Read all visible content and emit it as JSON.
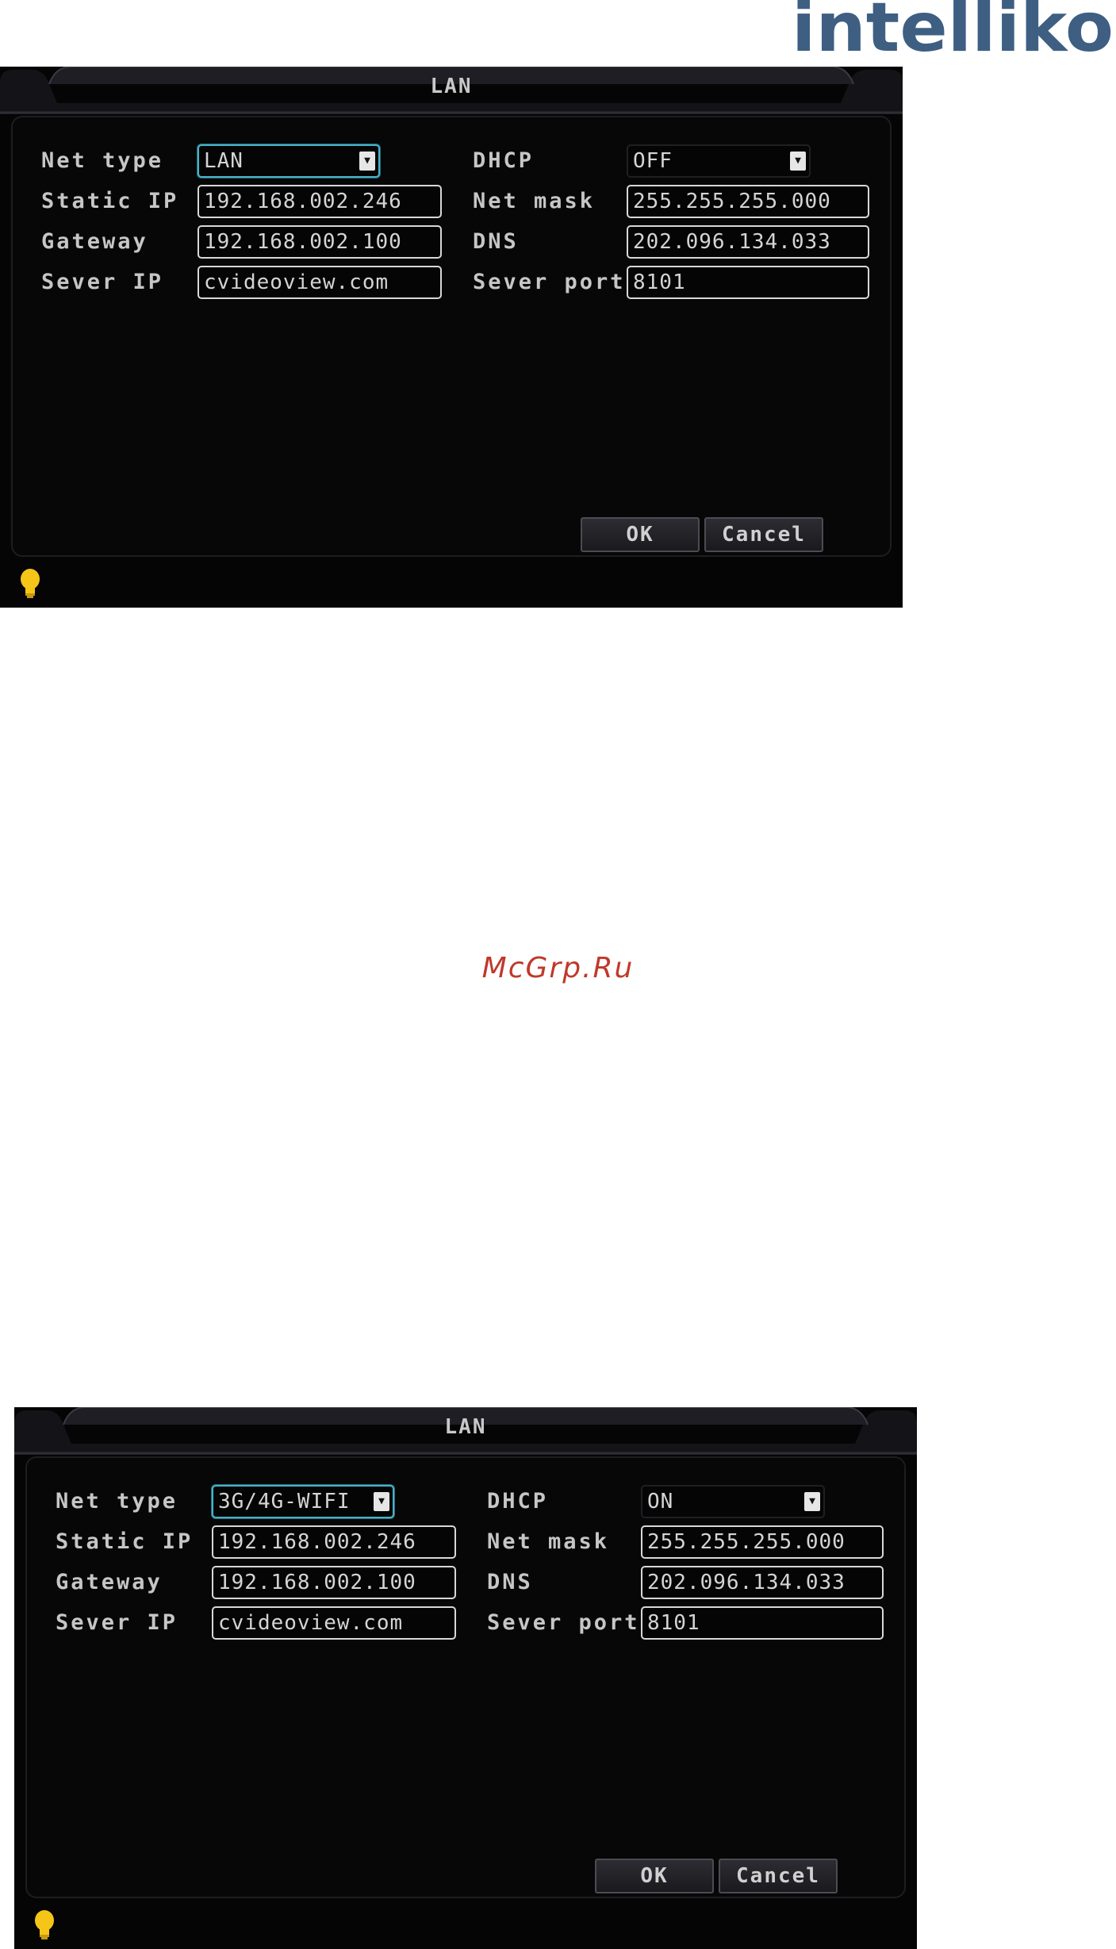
{
  "brand": {
    "logo_text": "intelliko",
    "color": "#4a6a8a"
  },
  "watermark": "McGrp.Ru",
  "screens": [
    {
      "title": "LAN",
      "net_type_label": "Net type",
      "net_type_value": "LAN",
      "dhcp_label": "DHCP",
      "dhcp_value": "OFF",
      "static_ip_label": "Static IP",
      "static_ip_value": "192.168.002.246",
      "net_mask_label": "Net mask",
      "net_mask_value": "255.255.255.000",
      "gateway_label": "Gateway",
      "gateway_value": "192.168.002.100",
      "dns_label": "DNS",
      "dns_value": "202.096.134.033",
      "sever_ip_label": "Sever IP",
      "sever_ip_value": "cvideoview.com",
      "sever_port_label": "Sever port",
      "sever_port_value": "8101",
      "ok_label": "OK",
      "cancel_label": "Cancel"
    },
    {
      "title": "LAN",
      "net_type_label": "Net type",
      "net_type_value": "3G/4G-WIFI",
      "dhcp_label": "DHCP",
      "dhcp_value": "ON",
      "static_ip_label": "Static IP",
      "static_ip_value": "192.168.002.246",
      "net_mask_label": "Net mask",
      "net_mask_value": "255.255.255.000",
      "gateway_label": "Gateway",
      "gateway_value": "192.168.002.100",
      "dns_label": "DNS",
      "dns_value": "202.096.134.033",
      "sever_ip_label": "Sever IP",
      "sever_ip_value": "cvideoview.com",
      "sever_port_label": "Sever port",
      "sever_port_value": "8101",
      "ok_label": "OK",
      "cancel_label": "Cancel"
    }
  ]
}
